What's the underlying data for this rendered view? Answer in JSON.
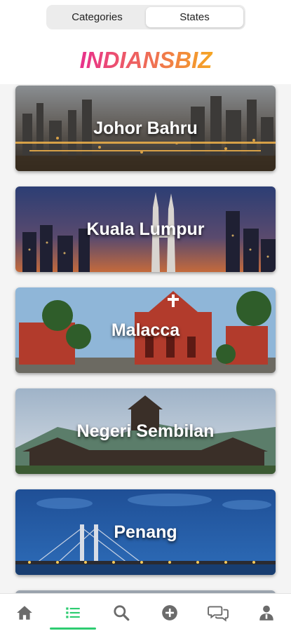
{
  "segmented": {
    "categories_label": "Categories",
    "states_label": "States",
    "selected": "States"
  },
  "logo": {
    "text": "INDIANSBIZ"
  },
  "states": [
    {
      "name": "Johor Bahru",
      "image": "city-skyline-dusk"
    },
    {
      "name": "Kuala Lumpur",
      "image": "petronas-towers-night"
    },
    {
      "name": "Malacca",
      "image": "red-church-square"
    },
    {
      "name": "Negeri Sembilan",
      "image": "traditional-palace"
    },
    {
      "name": "Penang",
      "image": "penang-bridge-night"
    }
  ],
  "tabbar": {
    "items": [
      {
        "icon": "home-icon",
        "active": false
      },
      {
        "icon": "list-icon",
        "active": true
      },
      {
        "icon": "search-icon",
        "active": false
      },
      {
        "icon": "add-circle-icon",
        "active": false
      },
      {
        "icon": "chat-icon",
        "active": false
      },
      {
        "icon": "profile-icon",
        "active": false
      }
    ]
  },
  "colors": {
    "accent": "#2ecc71",
    "logo_gradient_start": "#e8308c",
    "logo_gradient_end": "#f5a623",
    "icon_gray": "#6b6b6b"
  }
}
